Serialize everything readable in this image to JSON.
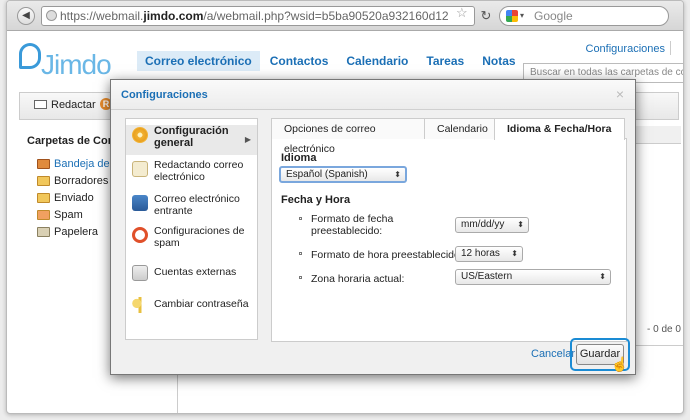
{
  "browser": {
    "url_prefix": "https://webmail.",
    "url_domain": "jimdo.com",
    "url_rest": "/a/webmail.php?wsid=b5ba90520a932160d12",
    "search_placeholder": "Google"
  },
  "app": {
    "logo_text": "Jimdo",
    "nav": [
      "Correo electrónico",
      "Contactos",
      "Calendario",
      "Tareas",
      "Notas"
    ],
    "config_link": "Configuraciones",
    "search_placeholder": "Buscar en todas las carpetas de cor",
    "toolbar": {
      "compose_label": "Redactar",
      "r_label": "R"
    },
    "folders_title": "Carpetas de Corre",
    "folders": [
      "Bandeja de e",
      "Borradores",
      "Enviado",
      "Spam",
      "Papelera"
    ],
    "page_count": "- 0 de 0"
  },
  "modal": {
    "title": "Configuraciones",
    "close_glyph": "×",
    "side_items": [
      {
        "label": "Configuración general",
        "color": "#f2b233"
      },
      {
        "label": "Redactando correo electrónico",
        "color": "#e6d6a0"
      },
      {
        "label": "Correo electrónico entrante",
        "color": "#4a86c8"
      },
      {
        "label": "Configuraciones de spam",
        "color": "#e0502a"
      },
      {
        "label": "Cuentas externas",
        "color": "#3aaa3a"
      },
      {
        "label": "Cambiar contraseña",
        "color": "#e8c040"
      }
    ],
    "tabs": [
      "Opciones de correo electrónico",
      "Calendario",
      "Idioma & Fecha/Hora"
    ],
    "idioma_label": "Idioma",
    "language_value": "Español (Spanish)",
    "fecha_label": "Fecha y Hora",
    "date_format_label": "Formato de fecha preestablecido:",
    "date_format_value": "mm/dd/yy",
    "time_format_label": "Formato de hora preestablecido:",
    "time_format_value": "12 horas",
    "timezone_label": "Zona horaria actual:",
    "timezone_value": "US/Eastern",
    "cancel_label": "Cancelar",
    "save_label": "Guardar"
  }
}
